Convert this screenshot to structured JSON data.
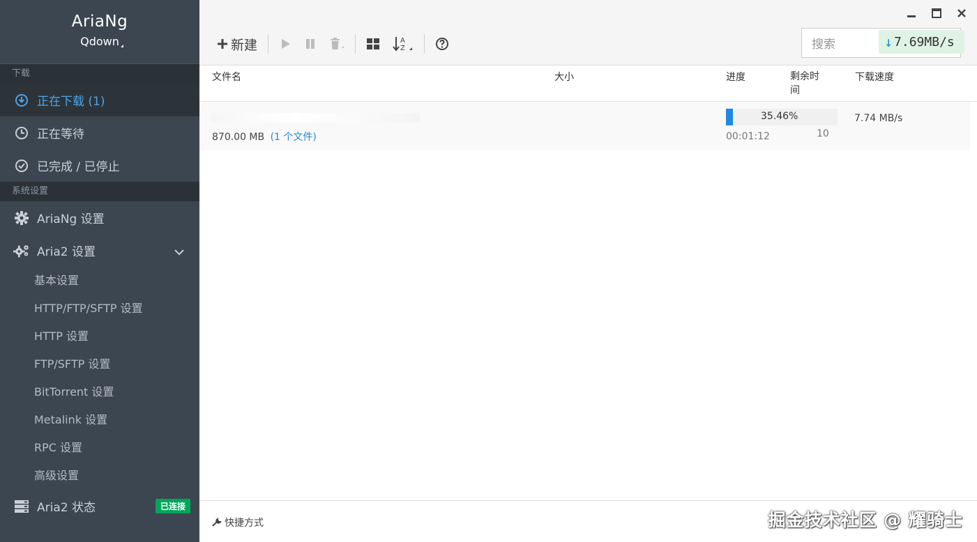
{
  "brand": {
    "title": "AriaNg",
    "subtitle": "Qdown"
  },
  "sidebar": {
    "sections": {
      "download": "下载",
      "settings": "系统设置"
    },
    "download_items": [
      {
        "label": "正在下载 (1)",
        "icon": "download-circle-icon",
        "active": true
      },
      {
        "label": "正在等待",
        "icon": "clock-icon",
        "active": false
      },
      {
        "label": "已完成 / 已停止",
        "icon": "check-circle-icon",
        "active": false
      }
    ],
    "ariang_settings": "AriaNg 设置",
    "aria2_settings": "Aria2 设置",
    "aria2_sub_items": [
      "基本设置",
      "HTTP/FTP/SFTP 设置",
      "HTTP 设置",
      "FTP/SFTP 设置",
      "BitTorrent 设置",
      "Metalink 设置",
      "RPC 设置",
      "高级设置"
    ],
    "aria2_status": "Aria2 状态",
    "aria2_status_badge": "已连接"
  },
  "toolbar": {
    "new_label": "新建",
    "search_placeholder": "搜索",
    "global_speed": "7.69MB/s"
  },
  "table": {
    "headers": {
      "name": "文件名",
      "size": "大小",
      "progress": "进度",
      "remaining": "剩余时间",
      "speed": "下载速度"
    },
    "tasks": [
      {
        "size": "870.00 MB",
        "files": "(1 个文件)",
        "progress_percent": 35.46,
        "progress_text": "35.46%",
        "eta": "00:01:12",
        "connections": "10",
        "speed": "7.74 MB/s"
      }
    ]
  },
  "footer": {
    "shortcut": "快捷方式",
    "watermark": "掘金技术社区 @ 耀骑士"
  },
  "colors": {
    "sidebar_bg": "#3c4650",
    "accent": "#1e88e5",
    "connected_badge": "#00a65a"
  }
}
